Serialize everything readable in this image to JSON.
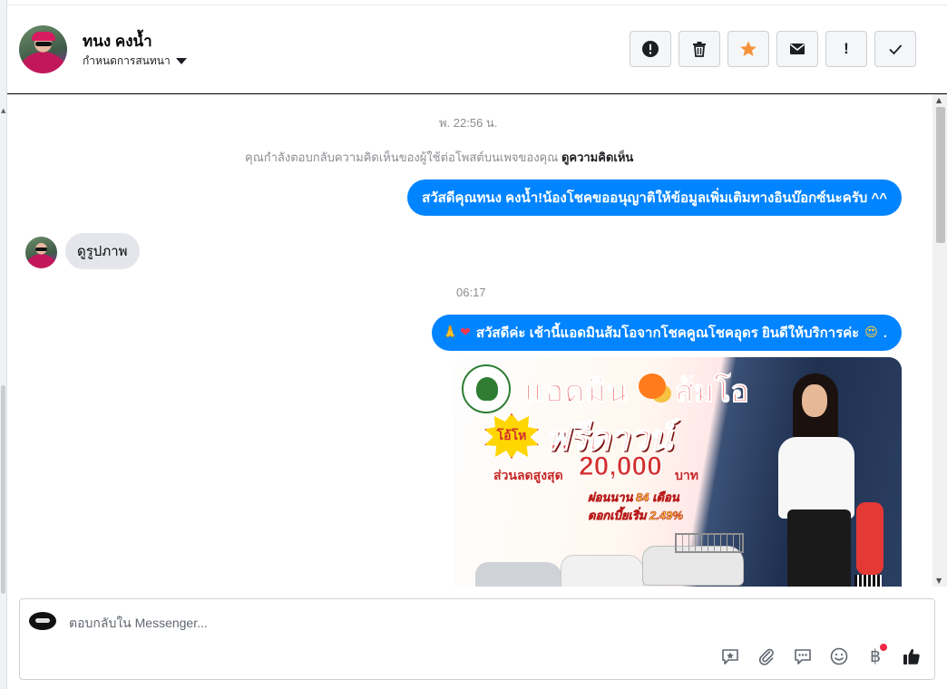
{
  "header": {
    "contact_name": "ทนง คงน้ำ",
    "conversation_menu": "กำหนดการสนทนา",
    "actions": [
      {
        "name": "report",
        "icon": "alert-circle-icon"
      },
      {
        "name": "delete",
        "icon": "trash-icon"
      },
      {
        "name": "star",
        "icon": "star-icon",
        "color": "#f7923b"
      },
      {
        "name": "mark-unread",
        "icon": "envelope-icon"
      },
      {
        "name": "flag",
        "icon": "exclamation-icon",
        "label": "!"
      },
      {
        "name": "done",
        "icon": "check-icon"
      }
    ]
  },
  "thread": {
    "timestamp_1": "พ. 22:56 น.",
    "notice_text": "คุณกำลังตอบกลับความคิดเห็นของผู้ใช้ต่อโพสต์บนเพจของคุณ",
    "notice_link": "ดูความคิดเห็น",
    "message_out_1": "สวัสดีคุณทนง คงน้ำ!น้องโชคขออนุญาติให้ข้อมูลเพิ่มเติมทางอินบ๊อกซ์นะครับ ^^",
    "message_in_1": "ดูรูปภาพ",
    "timestamp_2": "06:17",
    "message_out_2": {
      "emoji_1": "🙏",
      "emoji_2": "❤",
      "text": "สวัสดีค่ะ เช้านี้แอดมินส้มโอจากโชคคูณโชคอุดร ยินดีให้บริการค่ะ",
      "emoji_3": "😍",
      "end": "."
    },
    "ad_image": {
      "admin_word": "แอดมิน",
      "admin_name": "ส้มโอ",
      "burst": "โอ้โห",
      "headline": "ฟรีดาวน์",
      "discount_label": "ส่วนลดสูงสุด",
      "discount_value": "20,000",
      "discount_unit": "บาท",
      "term": "ผ่อนนาน 84 เดือน",
      "rate": "ดอกเบี้ยเริ่ม 2.49%"
    },
    "bubble_color": "#0084ff"
  },
  "composer": {
    "placeholder": "ตอบกลับใน Messenger...",
    "tools": [
      "saved-reply-icon",
      "attachment-icon",
      "chat-bubbles-icon",
      "emoji-icon",
      "baht-payment-icon",
      "like-icon"
    ],
    "baht_symbol": "฿"
  }
}
